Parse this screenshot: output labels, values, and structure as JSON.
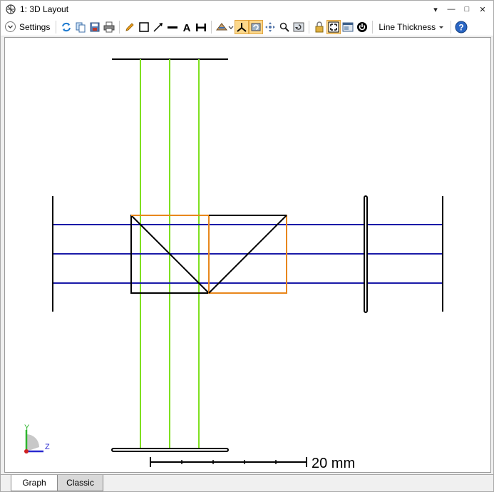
{
  "window": {
    "title": "1: 3D Layout",
    "controls": [
      "▾",
      "—",
      "□",
      "✕"
    ]
  },
  "toolbar": {
    "settings_label": "Settings",
    "line_thickness_label": "Line Thickness",
    "icons": [
      "refresh-icon",
      "copy-icon",
      "save-icon",
      "print-icon",
      "pencil-icon",
      "rectangle-icon",
      "arrow-icon",
      "line-icon",
      "text-icon",
      "dimension-icon",
      "view-rotate-icon",
      "axes-icon",
      "rotate-view-icon",
      "pan-icon",
      "zoom-icon",
      "undo-zoom-icon",
      "lock-icon",
      "fit-icon",
      "window-icon",
      "power-icon",
      "help-icon"
    ],
    "active_icons": [
      "axes-icon",
      "rotate-view-icon",
      "fit-icon"
    ]
  },
  "plot": {
    "scale_bar_label": "20 mm",
    "axis_y_label": "Y",
    "axis_z_label": "Z",
    "colors": {
      "green_rays": "#7fe020",
      "blue_rays": "#1a1aa8",
      "orange_prism": "#e8871c",
      "black_outline": "#000000"
    }
  },
  "tabs": [
    {
      "label": "Graph",
      "active": true
    },
    {
      "label": "Classic",
      "active": false
    }
  ]
}
